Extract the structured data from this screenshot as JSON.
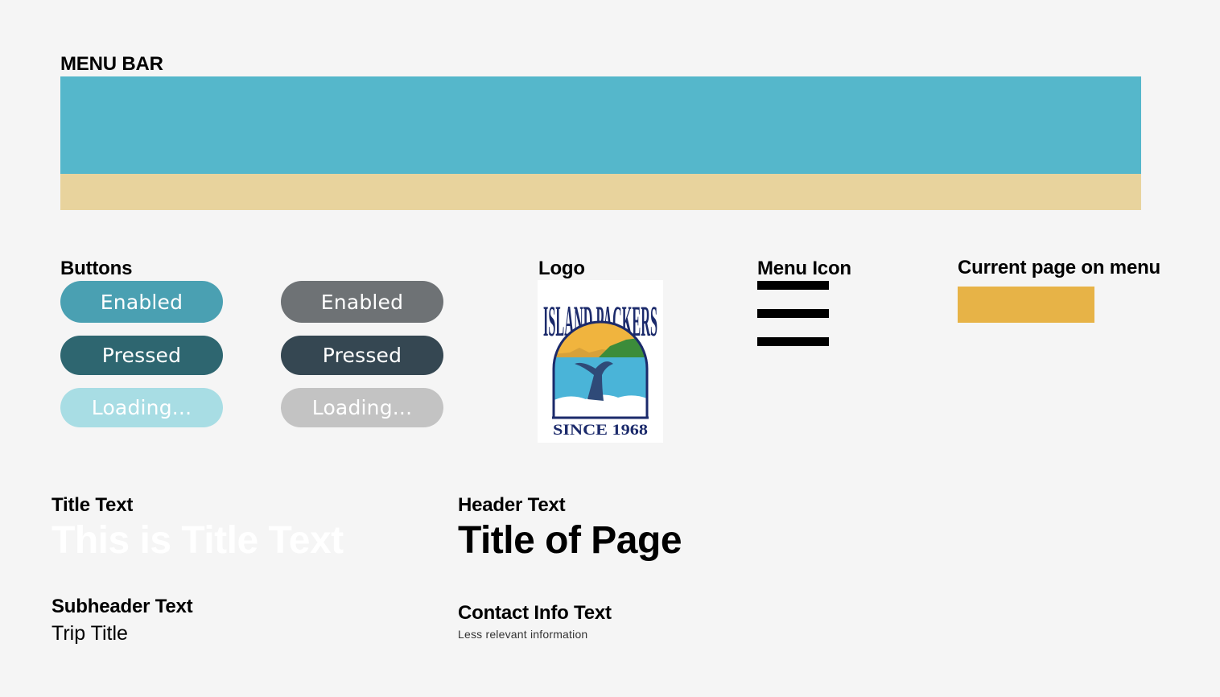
{
  "sections": {
    "menu_bar": "MENU BAR",
    "buttons": "Buttons",
    "logo": "Logo",
    "menu_icon": "Menu Icon",
    "current_page": "Current page on menu",
    "title_text": "Title Text",
    "header_text": "Header Text",
    "subheader_text": "Subheader Text",
    "contact_info_text": "Contact Info Text"
  },
  "buttons": {
    "teal": {
      "enabled_label": "Enabled",
      "pressed_label": "Pressed",
      "loading_label": "Loading..."
    },
    "gray": {
      "enabled_label": "Enabled",
      "pressed_label": "Pressed",
      "loading_label": "Loading..."
    }
  },
  "logo": {
    "top_text": "ISLAND PACKERS",
    "bottom_text": "SINCE 1968"
  },
  "samples": {
    "title_text": "This is Title Text",
    "header_text": "Title of Page",
    "subheader_text": "Trip Title",
    "contact_info_text": "Less relevant information"
  },
  "colors": {
    "menu_bar_primary": "#55b7cb",
    "menu_bar_secondary": "#e8d39d",
    "teal_enabled": "#4aa0b2",
    "teal_pressed": "#2e6670",
    "teal_loading": "#a8dde4",
    "gray_enabled": "#6e7275",
    "gray_pressed": "#354752",
    "gray_loading": "#c3c3c3",
    "current_page": "#e7b347",
    "title_text": "#ffffff",
    "background": "#f5f5f5"
  },
  "icons": {
    "menu_icon": "hamburger-icon",
    "logo": "island-packers-whale-logo"
  }
}
